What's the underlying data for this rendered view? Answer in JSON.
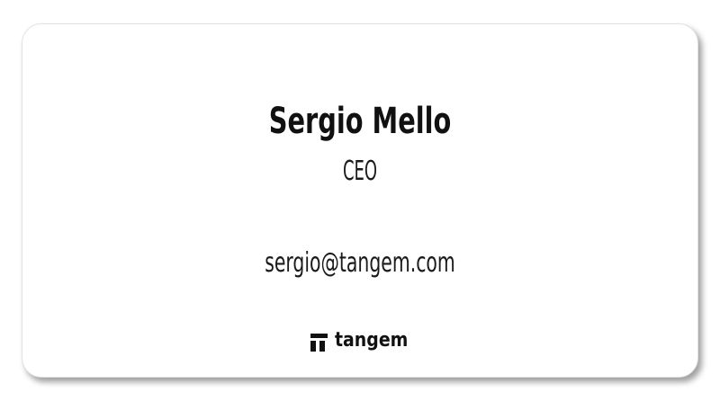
{
  "card": {
    "name": "Sergio Mello",
    "role": "CEO",
    "email": "sergio@tangem.com",
    "logo": {
      "icon": "tangem-logo-icon",
      "text": "tangem"
    }
  }
}
